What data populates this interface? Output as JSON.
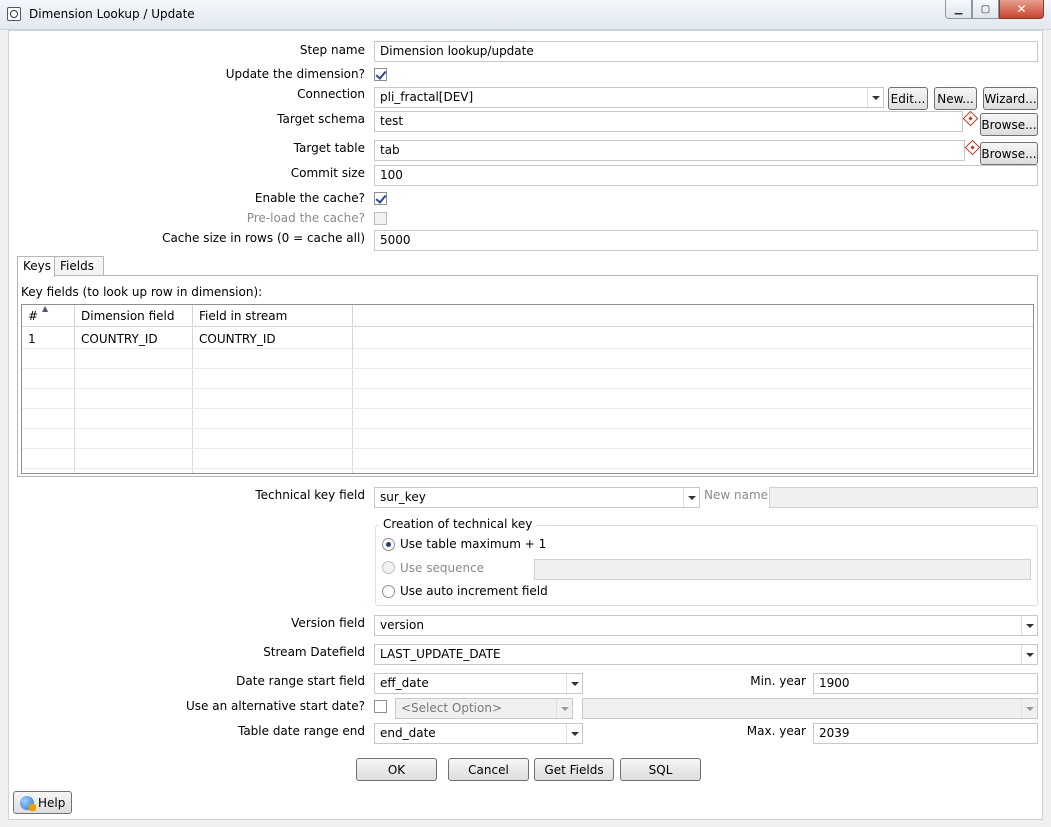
{
  "window": {
    "title": "Dimension Lookup / Update",
    "minimize_glyph": "▁",
    "maximize_glyph": "▢",
    "close_glyph": "✕"
  },
  "form": {
    "step_name_label": "Step name",
    "step_name_value": "Dimension lookup/update",
    "update_dimension_label": "Update the dimension?",
    "update_dimension_checked": true,
    "connection_label": "Connection",
    "connection_value": "pli_fractal[DEV]",
    "edit_button": "Edit...",
    "new_button": "New...",
    "wizard_button": "Wizard...",
    "target_schema_label": "Target schema",
    "target_schema_value": "test",
    "browse_button": "Browse...",
    "target_table_label": "Target table",
    "target_table_value": "tab",
    "commit_size_label": "Commit size",
    "commit_size_value": "100",
    "enable_cache_label": "Enable the cache?",
    "enable_cache_checked": true,
    "preload_cache_label": "Pre-load the cache?",
    "preload_cache_checked": false,
    "cache_size_label": "Cache size in rows (0 = cache all)",
    "cache_size_value": "5000"
  },
  "tabs": [
    {
      "label": "Keys",
      "active": true
    },
    {
      "label": "Fields",
      "active": false
    }
  ],
  "keys_panel": {
    "caption": "Key fields (to look up row in dimension):",
    "columns": [
      "#",
      "Dimension field",
      "Field in stream"
    ],
    "rows": [
      {
        "num": "1",
        "dimension_field": "COUNTRY_ID",
        "field_in_stream": "COUNTRY_ID"
      }
    ]
  },
  "technical": {
    "tech_key_label": "Technical key field",
    "tech_key_value": "sur_key",
    "new_name_label": "New name",
    "new_name_value": "",
    "group_title": "Creation of technical key",
    "opt_table_max": "Use table maximum + 1",
    "opt_sequence": "Use sequence",
    "sequence_value": "",
    "opt_auto_increment": "Use auto increment field",
    "selected_option": "table_max"
  },
  "versioning": {
    "version_field_label": "Version field",
    "version_field_value": "version",
    "stream_datefield_label": "Stream Datefield",
    "stream_datefield_value": "LAST_UPDATE_DATE",
    "date_start_label": "Date range start field",
    "date_start_value": "eff_date",
    "min_year_label": "Min. year",
    "min_year_value": "1900",
    "alt_start_label": "Use an alternative start date?",
    "alt_start_checked": false,
    "alt_start_select": "<Select Option>",
    "alt_start_extra": "",
    "date_end_label": "Table date range end",
    "date_end_value": "end_date",
    "max_year_label": "Max. year",
    "max_year_value": "2039"
  },
  "actions": {
    "ok": "OK",
    "cancel": "Cancel",
    "get_fields": "Get Fields",
    "sql": "SQL",
    "help": "Help"
  },
  "icons": {
    "app": "search-dialog-icon",
    "variable": "variable-diamond-icon",
    "help": "help-globe-icon"
  }
}
